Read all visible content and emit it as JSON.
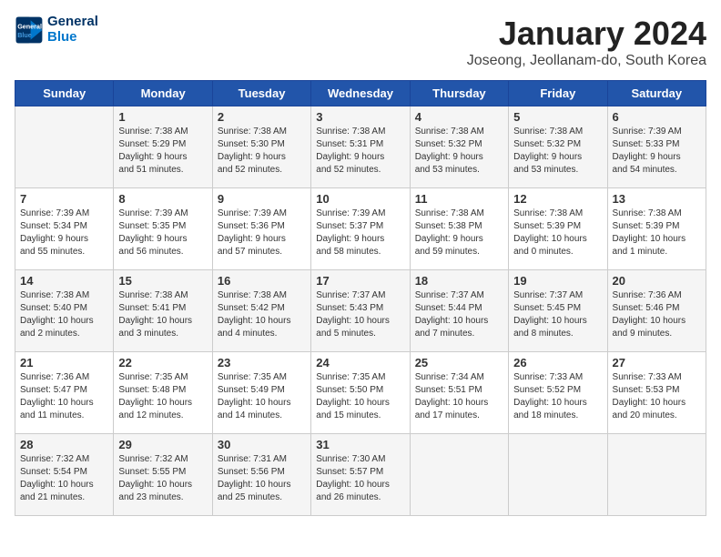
{
  "header": {
    "logo_line1": "General",
    "logo_line2": "Blue",
    "month_title": "January 2024",
    "location": "Joseong, Jeollanam-do, South Korea"
  },
  "days_of_week": [
    "Sunday",
    "Monday",
    "Tuesday",
    "Wednesday",
    "Thursday",
    "Friday",
    "Saturday"
  ],
  "weeks": [
    [
      {
        "day": "",
        "info": ""
      },
      {
        "day": "1",
        "info": "Sunrise: 7:38 AM\nSunset: 5:29 PM\nDaylight: 9 hours\nand 51 minutes."
      },
      {
        "day": "2",
        "info": "Sunrise: 7:38 AM\nSunset: 5:30 PM\nDaylight: 9 hours\nand 52 minutes."
      },
      {
        "day": "3",
        "info": "Sunrise: 7:38 AM\nSunset: 5:31 PM\nDaylight: 9 hours\nand 52 minutes."
      },
      {
        "day": "4",
        "info": "Sunrise: 7:38 AM\nSunset: 5:32 PM\nDaylight: 9 hours\nand 53 minutes."
      },
      {
        "day": "5",
        "info": "Sunrise: 7:38 AM\nSunset: 5:32 PM\nDaylight: 9 hours\nand 53 minutes."
      },
      {
        "day": "6",
        "info": "Sunrise: 7:39 AM\nSunset: 5:33 PM\nDaylight: 9 hours\nand 54 minutes."
      }
    ],
    [
      {
        "day": "7",
        "info": "Sunrise: 7:39 AM\nSunset: 5:34 PM\nDaylight: 9 hours\nand 55 minutes."
      },
      {
        "day": "8",
        "info": "Sunrise: 7:39 AM\nSunset: 5:35 PM\nDaylight: 9 hours\nand 56 minutes."
      },
      {
        "day": "9",
        "info": "Sunrise: 7:39 AM\nSunset: 5:36 PM\nDaylight: 9 hours\nand 57 minutes."
      },
      {
        "day": "10",
        "info": "Sunrise: 7:39 AM\nSunset: 5:37 PM\nDaylight: 9 hours\nand 58 minutes."
      },
      {
        "day": "11",
        "info": "Sunrise: 7:38 AM\nSunset: 5:38 PM\nDaylight: 9 hours\nand 59 minutes."
      },
      {
        "day": "12",
        "info": "Sunrise: 7:38 AM\nSunset: 5:39 PM\nDaylight: 10 hours\nand 0 minutes."
      },
      {
        "day": "13",
        "info": "Sunrise: 7:38 AM\nSunset: 5:39 PM\nDaylight: 10 hours\nand 1 minute."
      }
    ],
    [
      {
        "day": "14",
        "info": "Sunrise: 7:38 AM\nSunset: 5:40 PM\nDaylight: 10 hours\nand 2 minutes."
      },
      {
        "day": "15",
        "info": "Sunrise: 7:38 AM\nSunset: 5:41 PM\nDaylight: 10 hours\nand 3 minutes."
      },
      {
        "day": "16",
        "info": "Sunrise: 7:38 AM\nSunset: 5:42 PM\nDaylight: 10 hours\nand 4 minutes."
      },
      {
        "day": "17",
        "info": "Sunrise: 7:37 AM\nSunset: 5:43 PM\nDaylight: 10 hours\nand 5 minutes."
      },
      {
        "day": "18",
        "info": "Sunrise: 7:37 AM\nSunset: 5:44 PM\nDaylight: 10 hours\nand 7 minutes."
      },
      {
        "day": "19",
        "info": "Sunrise: 7:37 AM\nSunset: 5:45 PM\nDaylight: 10 hours\nand 8 minutes."
      },
      {
        "day": "20",
        "info": "Sunrise: 7:36 AM\nSunset: 5:46 PM\nDaylight: 10 hours\nand 9 minutes."
      }
    ],
    [
      {
        "day": "21",
        "info": "Sunrise: 7:36 AM\nSunset: 5:47 PM\nDaylight: 10 hours\nand 11 minutes."
      },
      {
        "day": "22",
        "info": "Sunrise: 7:35 AM\nSunset: 5:48 PM\nDaylight: 10 hours\nand 12 minutes."
      },
      {
        "day": "23",
        "info": "Sunrise: 7:35 AM\nSunset: 5:49 PM\nDaylight: 10 hours\nand 14 minutes."
      },
      {
        "day": "24",
        "info": "Sunrise: 7:35 AM\nSunset: 5:50 PM\nDaylight: 10 hours\nand 15 minutes."
      },
      {
        "day": "25",
        "info": "Sunrise: 7:34 AM\nSunset: 5:51 PM\nDaylight: 10 hours\nand 17 minutes."
      },
      {
        "day": "26",
        "info": "Sunrise: 7:33 AM\nSunset: 5:52 PM\nDaylight: 10 hours\nand 18 minutes."
      },
      {
        "day": "27",
        "info": "Sunrise: 7:33 AM\nSunset: 5:53 PM\nDaylight: 10 hours\nand 20 minutes."
      }
    ],
    [
      {
        "day": "28",
        "info": "Sunrise: 7:32 AM\nSunset: 5:54 PM\nDaylight: 10 hours\nand 21 minutes."
      },
      {
        "day": "29",
        "info": "Sunrise: 7:32 AM\nSunset: 5:55 PM\nDaylight: 10 hours\nand 23 minutes."
      },
      {
        "day": "30",
        "info": "Sunrise: 7:31 AM\nSunset: 5:56 PM\nDaylight: 10 hours\nand 25 minutes."
      },
      {
        "day": "31",
        "info": "Sunrise: 7:30 AM\nSunset: 5:57 PM\nDaylight: 10 hours\nand 26 minutes."
      },
      {
        "day": "",
        "info": ""
      },
      {
        "day": "",
        "info": ""
      },
      {
        "day": "",
        "info": ""
      }
    ]
  ]
}
